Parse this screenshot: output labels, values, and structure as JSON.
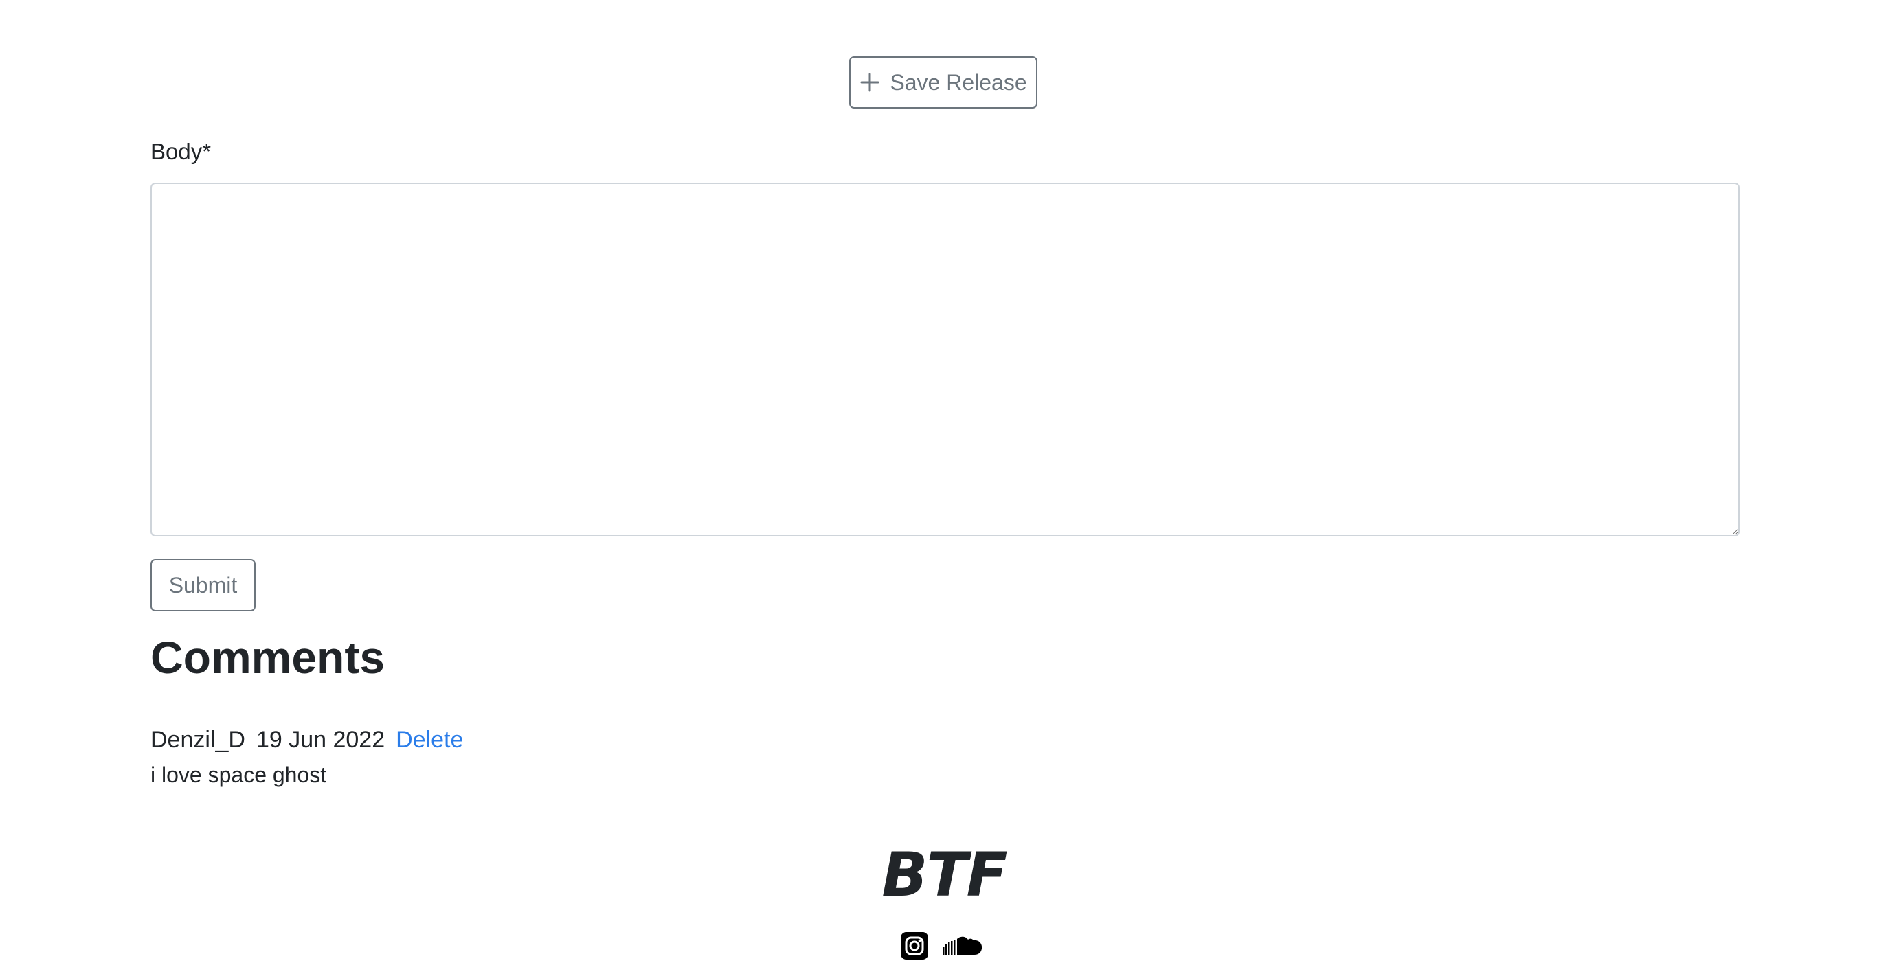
{
  "form": {
    "save_release_label": "Save Release",
    "body_label": "Body*",
    "body_value": "",
    "submit_label": "Submit"
  },
  "comments": {
    "heading": "Comments",
    "items": [
      {
        "author": "Denzil_D",
        "date": "19 Jun 2022",
        "delete_label": "Delete",
        "text": "i love space ghost"
      }
    ]
  },
  "footer": {
    "logo_text": "BTF",
    "social_icons": [
      "instagram-icon",
      "soundcloud-icon"
    ]
  },
  "colors": {
    "link": "#2b7de9",
    "button_border": "#6c757d",
    "text": "#212529"
  }
}
